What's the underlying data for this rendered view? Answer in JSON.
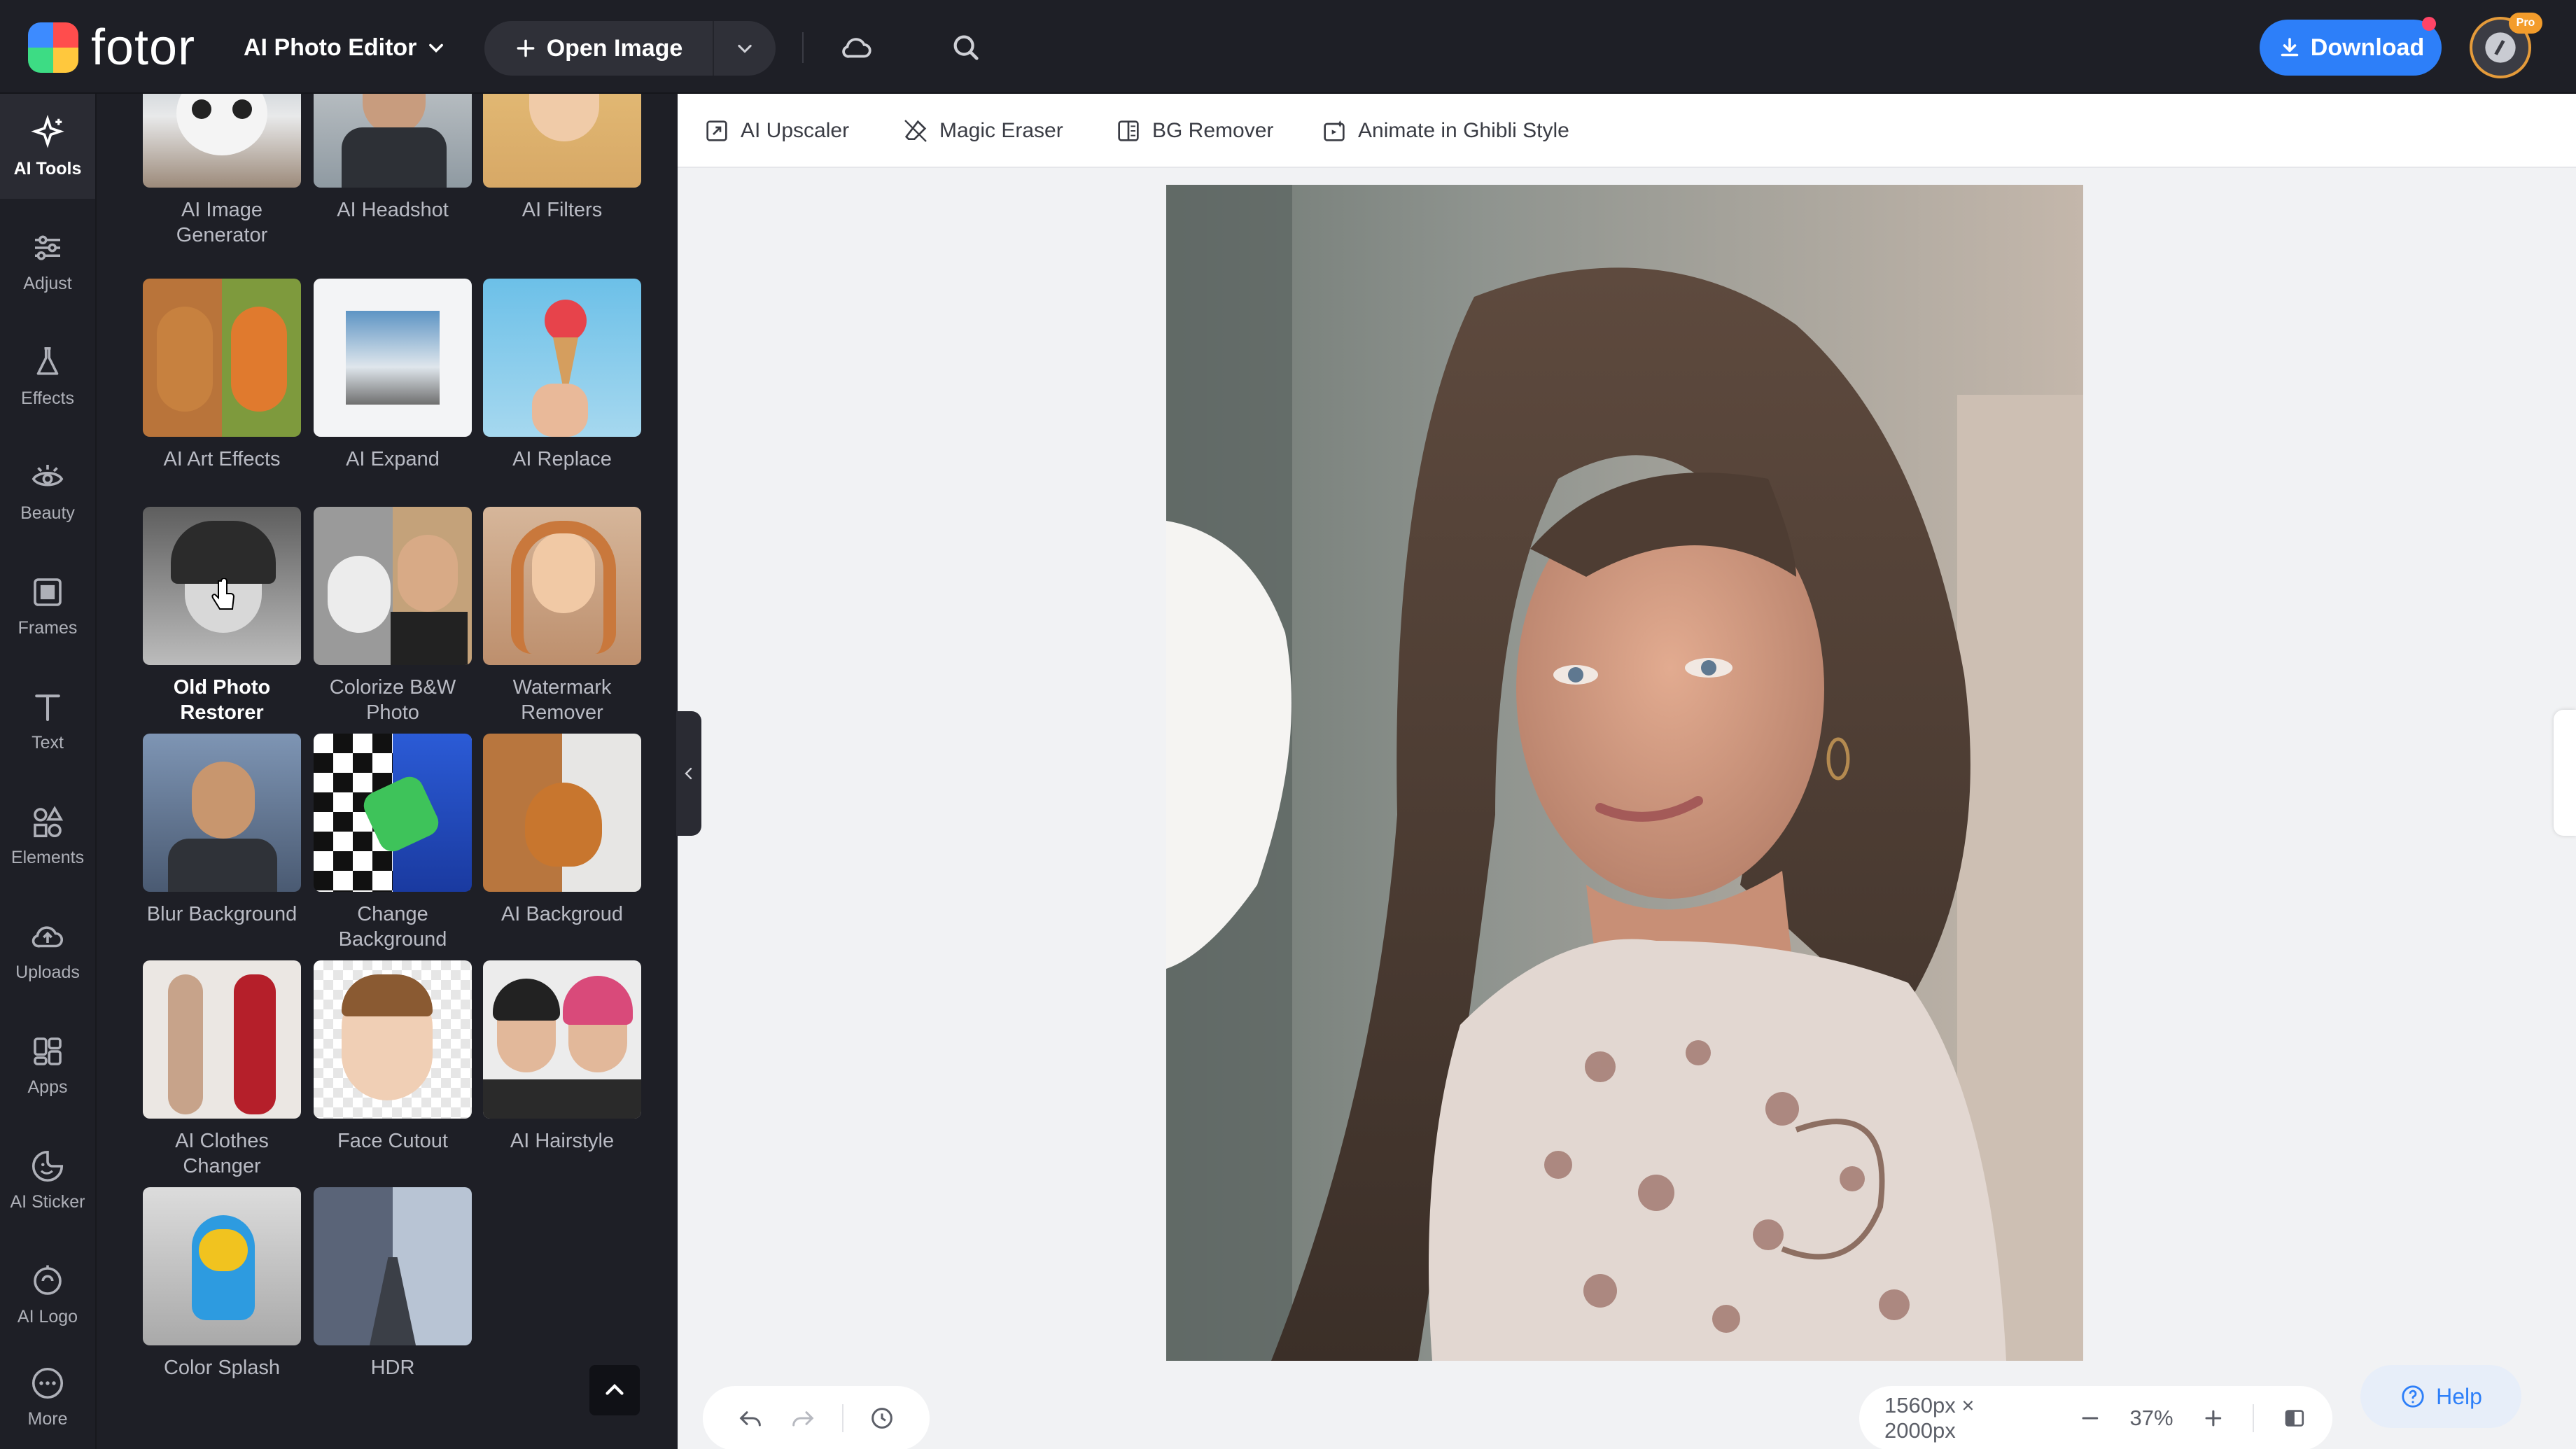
{
  "app": {
    "logo_text": "fotor",
    "editor_mode": "AI Photo Editor",
    "open_image_label": "Open Image",
    "download_label": "Download",
    "pro_badge": "Pro",
    "accent_color": "#2d7ff9"
  },
  "rail": {
    "items": [
      {
        "label": "AI Tools",
        "icon": "sparkle-icon",
        "active": true
      },
      {
        "label": "Adjust",
        "icon": "sliders-icon"
      },
      {
        "label": "Effects",
        "icon": "flask-icon"
      },
      {
        "label": "Beauty",
        "icon": "eye-icon"
      },
      {
        "label": "Frames",
        "icon": "frame-icon"
      },
      {
        "label": "Text",
        "icon": "text-icon"
      },
      {
        "label": "Elements",
        "icon": "shapes-icon"
      },
      {
        "label": "Uploads",
        "icon": "cloud-upload-icon"
      },
      {
        "label": "Apps",
        "icon": "apps-icon"
      },
      {
        "label": "AI Sticker",
        "icon": "sticker-icon"
      },
      {
        "label": "AI Logo",
        "icon": "logo-icon"
      },
      {
        "label": "More",
        "icon": "more-icon"
      }
    ]
  },
  "tools": [
    {
      "label": "AI Image Generator",
      "line1": "AI Image",
      "line2": "Generator"
    },
    {
      "label": "AI Headshot",
      "line1": "AI Headshot",
      "line2": ""
    },
    {
      "label": "AI Filters",
      "line1": "AI Filters",
      "line2": ""
    },
    {
      "label": "AI Art Effects",
      "line1": "AI Art Effects",
      "line2": ""
    },
    {
      "label": "AI Expand",
      "line1": "AI Expand",
      "line2": ""
    },
    {
      "label": "AI Replace",
      "line1": "AI Replace",
      "line2": ""
    },
    {
      "label": "Old Photo Restorer",
      "line1": "Old Photo",
      "line2": "Restorer",
      "active": true
    },
    {
      "label": "Colorize B&W Photo",
      "line1": "Colorize B&W",
      "line2": "Photo"
    },
    {
      "label": "Watermark Remover",
      "line1": "Watermark",
      "line2": "Remover"
    },
    {
      "label": "Blur Background",
      "line1": "Blur Background",
      "line2": ""
    },
    {
      "label": "Change Background",
      "line1": "Change",
      "line2": "Background"
    },
    {
      "label": "AI Backgroud",
      "line1": "AI Backgroud",
      "line2": ""
    },
    {
      "label": "AI Clothes Changer",
      "line1": "AI Clothes",
      "line2": "Changer"
    },
    {
      "label": "Face Cutout",
      "line1": "Face Cutout",
      "line2": ""
    },
    {
      "label": "AI Hairstyle",
      "line1": "AI Hairstyle",
      "line2": ""
    },
    {
      "label": "Color Splash",
      "line1": "Color Splash",
      "line2": ""
    },
    {
      "label": "HDR",
      "line1": "HDR",
      "line2": ""
    }
  ],
  "subbar": {
    "upscaler": "AI Upscaler",
    "magic_eraser": "Magic Eraser",
    "bg_remover": "BG Remover",
    "ghibli": "Animate in Ghibli Style"
  },
  "status": {
    "image_size": "1560px × 2000px",
    "zoom": "37%",
    "help_label": "Help"
  }
}
